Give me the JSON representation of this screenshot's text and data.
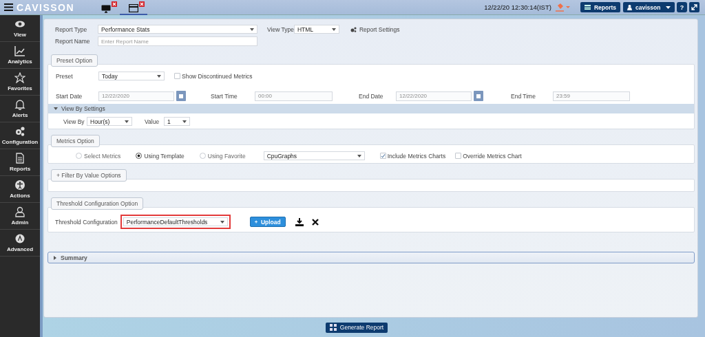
{
  "header": {
    "logo": "CAVISSON",
    "tabs": [
      {
        "kind": "monitor",
        "selected": false
      },
      {
        "kind": "window",
        "selected": true
      }
    ],
    "datetime": "12/22/20 12:30:14(IST)",
    "reports_button": "Reports",
    "user_button": "cavisson",
    "help_button": "?"
  },
  "sidebar": {
    "items": [
      {
        "label": "View",
        "kind": "eye"
      },
      {
        "label": "Analytics",
        "kind": "chart"
      },
      {
        "label": "Favorites",
        "kind": "star"
      },
      {
        "label": "Alerts",
        "kind": "bell"
      },
      {
        "label": "Configuration",
        "kind": "gears"
      },
      {
        "label": "Reports",
        "kind": "document"
      },
      {
        "label": "Actions",
        "kind": "figure"
      },
      {
        "label": "Admin",
        "kind": "user"
      },
      {
        "label": "Advanced",
        "kind": "badge"
      }
    ]
  },
  "form": {
    "report_type": {
      "label": "Report Type",
      "value": "Performance Stats"
    },
    "view_type": {
      "label": "View Type",
      "value": "HTML"
    },
    "report_settings": "Report Settings",
    "report_name": {
      "label": "Report Name",
      "placeholder": "Enter Report Name"
    }
  },
  "preset_section": {
    "title": "Preset Option",
    "preset": {
      "label": "Preset",
      "value": "Today"
    },
    "show_discontinued": {
      "label": "Show Discontinued Metrics",
      "checked": false
    },
    "start_date": {
      "label": "Start Date",
      "value": "12/22/2020"
    },
    "start_time": {
      "label": "Start Time",
      "value": "00:00"
    },
    "end_date": {
      "label": "End Date",
      "value": "12/22/2020"
    },
    "end_time": {
      "label": "End Time",
      "value": "23:59"
    },
    "view_by_settings": {
      "title": "View By Settings",
      "expanded": true,
      "view_by": {
        "label": "View By",
        "value": "Hour(s)"
      },
      "value": {
        "label": "Value",
        "value": "1"
      }
    }
  },
  "metrics_section": {
    "title": "Metrics Option",
    "options": [
      {
        "label": "Select Metrics",
        "selected": false
      },
      {
        "label": "Using Template",
        "selected": true
      },
      {
        "label": "Using Favorite",
        "selected": false
      }
    ],
    "template": "CpuGraphs",
    "include_charts": {
      "label": "Include Metrics Charts",
      "checked": true
    },
    "override_chart": {
      "label": "Override Metrics Chart",
      "checked": false
    }
  },
  "filter_section": {
    "title": "+ Filter By Value Options"
  },
  "threshold_section": {
    "title": "Threshold Configuration Option",
    "config": {
      "label": "Threshold Configuration",
      "value": "PerformanceDefaultThresholds",
      "highlighted": true
    },
    "upload_button": "Upload"
  },
  "summary": {
    "title": "Summary",
    "expanded": false
  },
  "generate_button": "Generate Report"
}
